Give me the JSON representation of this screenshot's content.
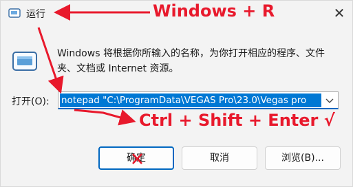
{
  "window": {
    "title": "运行",
    "close_glyph": "✕"
  },
  "dialog": {
    "description": "Windows 将根据你所输入的名称，为你打开相应的程序、文件夹、文档或 Internet 资源。",
    "open_label": "打开(O):",
    "command_value": "notepad \"C:\\ProgramData\\VEGAS Pro\\23.0\\Vegas pro"
  },
  "buttons": {
    "ok": "确定",
    "cancel": "取消",
    "browse": "浏览(B)..."
  },
  "annotations": {
    "shortcut_open": "Windows + R",
    "shortcut_run_admin": "Ctrl + Shift + Enter √"
  },
  "colors": {
    "annotation_red": "#e8192c",
    "selection_blue": "#0078d4",
    "accent_border": "#0067c0"
  },
  "icons": {
    "title_icon": "run-icon",
    "dialog_icon": "run-icon",
    "dropdown": "chevron-down-icon",
    "ok_strike": "red-x-icon"
  }
}
